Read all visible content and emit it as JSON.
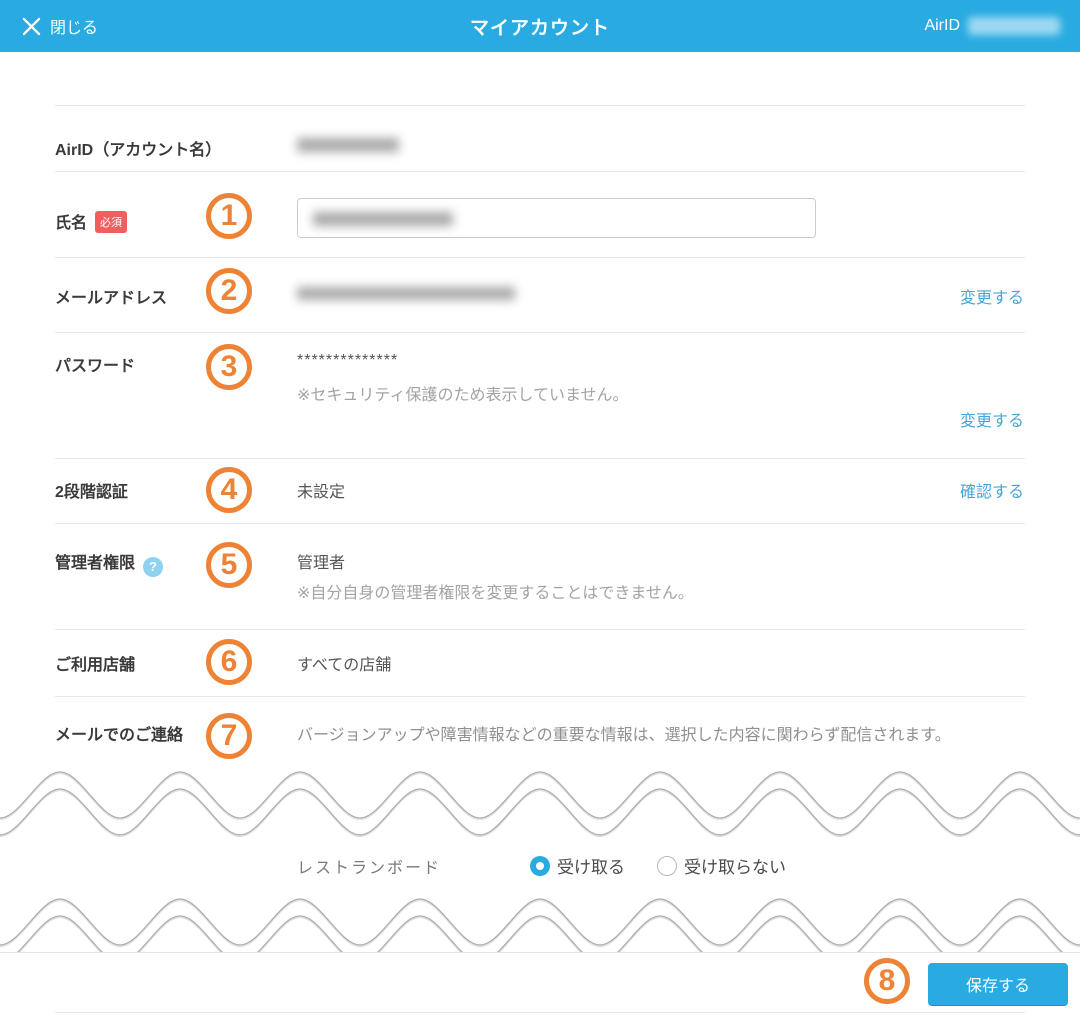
{
  "header": {
    "close_label": "閉じる",
    "title": "マイアカウント",
    "airid_label": "AirID",
    "airid_value_redacted": true
  },
  "colors": {
    "accent_blue": "#29ABE2",
    "link_blue": "#45A7D8",
    "annotation_orange": "#EE8335",
    "required_red": "#F15E5E"
  },
  "annotations": [
    "1",
    "2",
    "3",
    "4",
    "5",
    "6",
    "7",
    "8"
  ],
  "form": {
    "airid": {
      "label": "AirID（アカウント名）",
      "value_redacted": true
    },
    "name": {
      "label": "氏名",
      "required_badge": "必須",
      "input_value_redacted": true
    },
    "email": {
      "label": "メールアドレス",
      "value_redacted": true,
      "action": "変更する"
    },
    "password": {
      "label": "パスワード",
      "value": "**************",
      "note": "※セキュリティ保護のため表示していません。",
      "action": "変更する"
    },
    "two_factor": {
      "label": "2段階認証",
      "value": "未設定",
      "action": "確認する"
    },
    "admin": {
      "label": "管理者権限",
      "help_icon": "?",
      "value": "管理者",
      "note": "※自分自身の管理者権限を変更することはできません。"
    },
    "stores": {
      "label": "ご利用店舗",
      "value": "すべての店舗"
    },
    "mail_contact": {
      "label": "メールでのご連絡",
      "note": "バージョンアップや障害情報などの重要な情報は、選択した内容に関わらず配信されます。"
    },
    "restaurant_board": {
      "label": "レストランボード",
      "options": [
        {
          "label": "受け取る",
          "selected": true
        },
        {
          "label": "受け取らない",
          "selected": false
        }
      ]
    }
  },
  "footer": {
    "save_label": "保存する"
  }
}
